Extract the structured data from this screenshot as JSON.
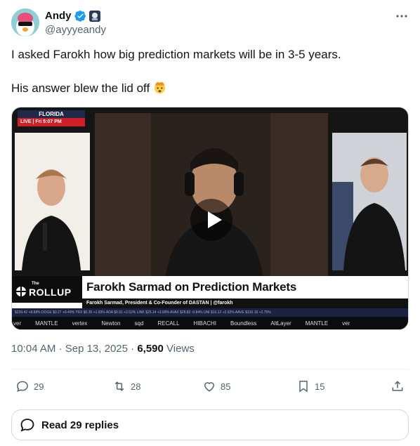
{
  "author": {
    "display_name": "Andy",
    "handle": "@ayyyeandy",
    "icons": [
      "avatar",
      "verified-badge-icon",
      "affiliate-badge-icon"
    ]
  },
  "tweet": {
    "line1": "I asked Farokh how big prediction markets will be in 3-5 years.",
    "line2": "His answer blew the lid off",
    "emoji": "exploding-head-emoji"
  },
  "video": {
    "location": "FLORIDA",
    "live": "LIVE",
    "time": "Fri 5:07 PM",
    "show_the": "The",
    "show_name": "ROLLUP",
    "headline": "Farokh Sarmad on Prediction Markets",
    "subline": "Farokh Sarmad, President & Co-Founder of DASTAN | @farokh",
    "ticker": "$239.42 +8.88%   DOGE $0.27 +9.49%   TRX $0.35 +1.93%   ADA $0.91 +2.52%   LINK $25.14 +3.99%   AVAX $28.82 -0.84%   UNI $10.12 +2.92%   AAVE $316.16 +2.75%",
    "sponsors": [
      "ver",
      "MANTLE",
      "vertex",
      "Newton",
      "sqd",
      "RECALL",
      "HIBACHI",
      "Boundless",
      "AltLayer",
      "MANTLE",
      "ver"
    ]
  },
  "meta": {
    "time": "10:04 AM",
    "sep1": "·",
    "date": "Sep 13, 2025",
    "sep2": "·",
    "views": "6,590",
    "views_label": "Views"
  },
  "actions": {
    "replies": "29",
    "retweets": "28",
    "likes": "85",
    "bookmarks": "15"
  },
  "read_replies": "Read 29 replies",
  "colors": {
    "verified": "#1d9bf0",
    "text": "#0f1419",
    "muted": "#536471",
    "border": "#cfd9de"
  }
}
